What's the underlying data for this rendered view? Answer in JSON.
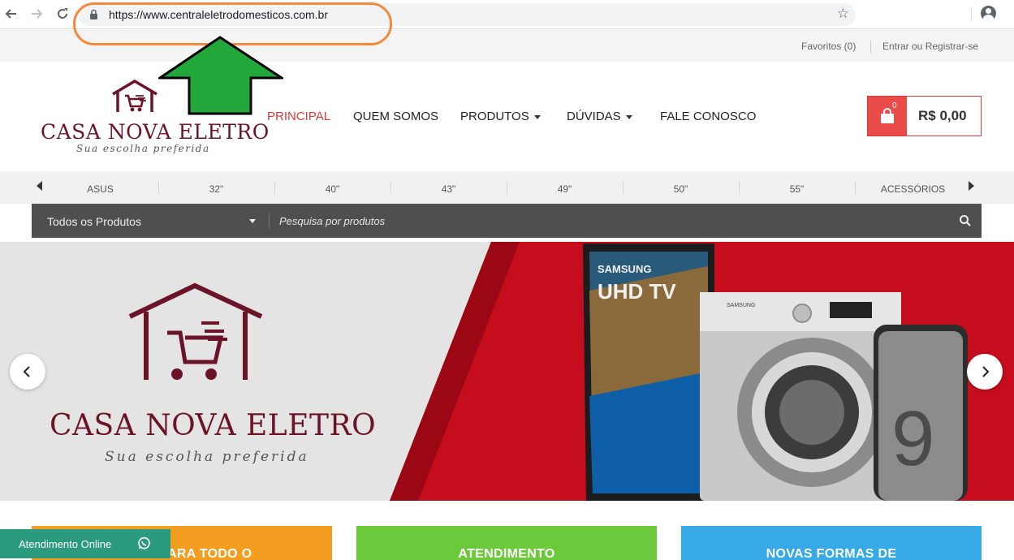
{
  "browser": {
    "url": "https://www.centraleletrodomesticos.com.br"
  },
  "topbar": {
    "favorites": "Favoritos (0)",
    "login": "Entrar ou Registrar-se"
  },
  "logo": {
    "title": "CASA NOVA ELETRO",
    "subtitle": "Sua escolha preferida"
  },
  "menu": {
    "items": [
      {
        "label": "PRINCIPAL",
        "active": true,
        "dropdown": false
      },
      {
        "label": "QUEM SOMOS",
        "active": false,
        "dropdown": false
      },
      {
        "label": "PRODUTOS",
        "active": false,
        "dropdown": true
      },
      {
        "label": "DÚVIDAS",
        "active": false,
        "dropdown": true
      },
      {
        "label": "FALE CONOSCO",
        "active": false,
        "dropdown": false
      }
    ]
  },
  "cart": {
    "count": "0",
    "total": "R$ 0,00"
  },
  "categories": [
    "ASUS",
    "32\"",
    "40\"",
    "43\"",
    "49\"",
    "50\"",
    "55\"",
    "ACESSÓRIOS"
  ],
  "search": {
    "category": "Todos os Produtos",
    "placeholder": "Pesquisa por produtos"
  },
  "hero": {
    "title": "CASA NOVA ELETRO",
    "subtitle": "Sua escolha preferida",
    "tv_brand": "SAMSUNG",
    "tv_label": "UHD TV",
    "washer_brand": "SAMSUNG",
    "phone_label": "9"
  },
  "tiles": [
    {
      "label": "FRETE PARA TODO O"
    },
    {
      "label": "ATENDIMENTO"
    },
    {
      "label": "NOVAS FORMAS DE"
    }
  ],
  "chat": {
    "label": "Atendimento Online"
  },
  "colors": {
    "brand": "#6b1428",
    "accent": "#d63b3b",
    "hero_red": "#c50d1d",
    "annotation_orange": "#f4893b",
    "annotation_arrow": "#22a83a",
    "chat_green": "#2c9a7d"
  },
  "icons": [
    "back-arrow-icon",
    "forward-arrow-icon",
    "reload-icon",
    "lock-icon",
    "star-icon",
    "profile-icon",
    "house-cart-icon",
    "shopping-bag-icon",
    "search-icon",
    "chevron-left-icon",
    "chevron-right-icon",
    "whatsapp-icon"
  ]
}
